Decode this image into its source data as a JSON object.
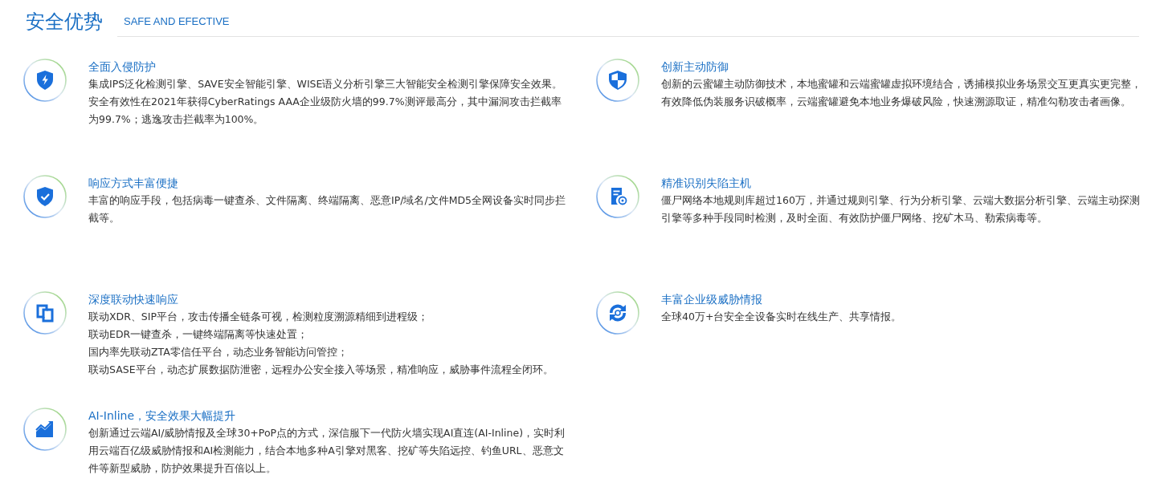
{
  "header": {
    "title": "安全优势",
    "subtitle": "SAFE AND EFECTIVE"
  },
  "features": [
    {
      "title": "全面入侵防护",
      "paragraphs": [
        "集成IPS泛化检测引擎、SAVE安全智能引擎、WISE语义分析引擎三大智能安全检测引擎保障安全效果。安全有效性在2021年获得CyberRatings AAA企业级防火墙的99.7%测评最高分，其中漏洞攻击拦截率为99.7%；逃逸攻击拦截率为100%。"
      ]
    },
    {
      "title": "创新主动防御",
      "paragraphs": [
        "创新的云蜜罐主动防御技术，本地蜜罐和云端蜜罐虚拟环境结合，诱捕模拟业务场景交互更真实更完整，有效降低伪装服务识破概率，云端蜜罐避免本地业务爆破风险，快速溯源取证，精准勾勒攻击者画像。"
      ]
    },
    {
      "title": "响应方式丰富便捷",
      "paragraphs": [
        "丰富的响应手段，包括病毒一键查杀、文件隔离、终端隔离、恶意IP/域名/文件MD5全网设备实时同步拦截等。"
      ]
    },
    {
      "title": "精准识别失陷主机",
      "paragraphs": [
        "僵尸网络本地规则库超过160万，并通过规则引擎、行为分析引擎、云端大数据分析引擎、云端主动探测引擎等多种手段同时检测，及时全面、有效防护僵尸网络、挖矿木马、勒索病毒等。"
      ]
    },
    {
      "title": "深度联动快速响应",
      "paragraphs": [
        "联动XDR、SIP平台，攻击传播全链条可视，检测粒度溯源精细到进程级；",
        "联动EDR一键查杀，一键终端隔离等快速处置；",
        "国内率先联动ZTA零信任平台，动态业务智能访问管控；",
        "联动SASE平台，动态扩展数据防泄密，远程办公安全接入等场景，精准响应，威胁事件流程全闭环。"
      ]
    },
    {
      "title": "丰富企业级威胁情报",
      "paragraphs": [
        "全球40万+台安全全设备实时在线生产、共享情报。"
      ]
    },
    {
      "title": "AI-Inline，安全效果大幅提升",
      "paragraphs": [
        "创新通过云端AI/威胁情报及全球30+PoP点的方式，深信服下一代防火墙实现AI直连(AI-Inline)，实时利用云端百亿级威胁情报和AI检测能力，结合本地多种A引擎对黑客、挖矿等失陷远控、钓鱼URL、恶意文件等新型威胁，防护效果提升百倍以上。"
      ]
    }
  ]
}
